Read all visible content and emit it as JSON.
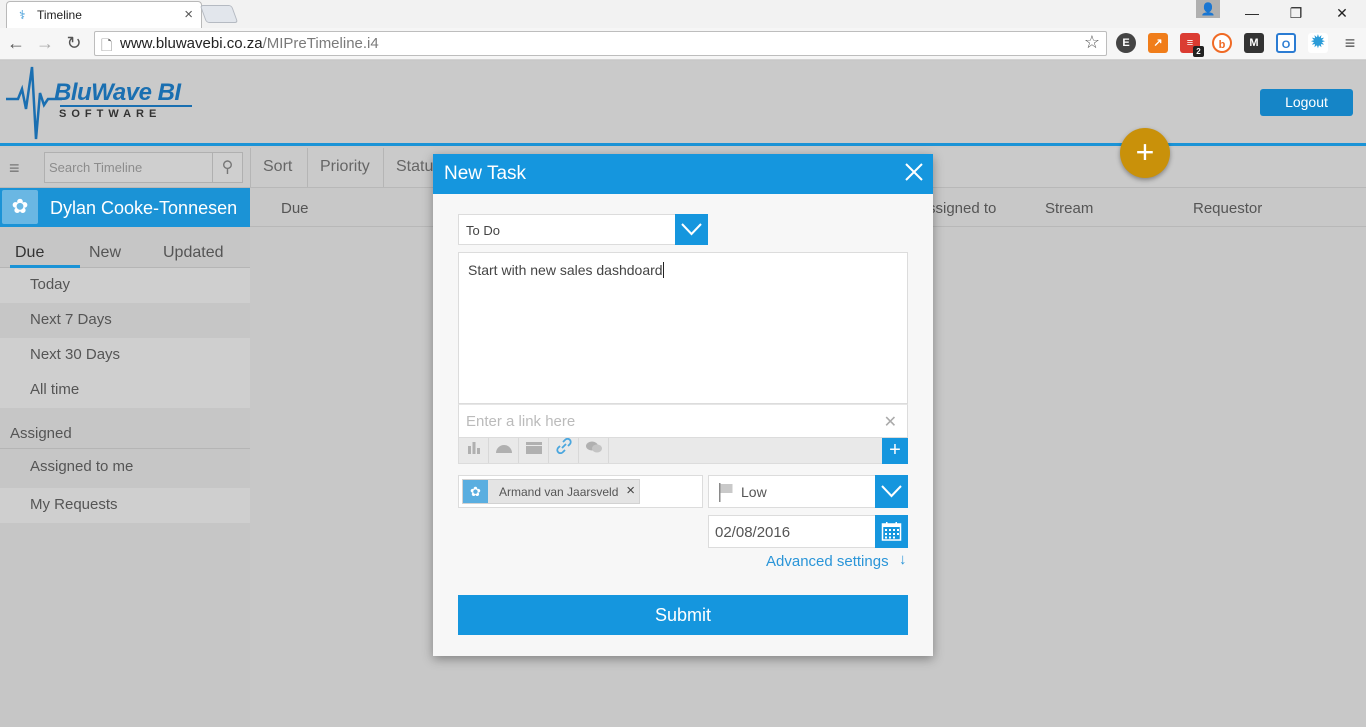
{
  "browser": {
    "tab_title": "Timeline",
    "url_domain": "www.bluwavebi.co.za",
    "url_path": "/MIPreTimeline.i4",
    "extension_badge": "2"
  },
  "header": {
    "logo_title": "BluWave BI",
    "logo_subtitle": "SOFTWARE",
    "logout_label": "Logout",
    "fab_label": "+"
  },
  "filterbar": {
    "search_placeholder": "Search Timeline",
    "items": [
      "Sort",
      "Priority",
      "Status"
    ]
  },
  "sidebar": {
    "user_name": "Dylan Cooke-Tonnesen",
    "tabs": [
      "Due",
      "New",
      "Updated"
    ],
    "due_items": [
      "Today",
      "Next 7 Days",
      "Next 30 Days",
      "All time"
    ],
    "assigned_heading": "Assigned",
    "assigned_items": [
      "Assigned to me",
      "My Requests"
    ]
  },
  "columns": [
    "Due",
    "Assigned to",
    "Stream",
    "Requestor"
  ],
  "modal": {
    "title": "New Task",
    "status_value": "To Do",
    "description": "Start with new sales dashdoard",
    "link_placeholder": "Enter a link here",
    "assignee": "Armand van Jaarsveld",
    "priority": "Low",
    "date": "02/08/2016",
    "advanced_label": "Advanced settings",
    "submit_label": "Submit"
  },
  "colors": {
    "accent": "#1596de",
    "fab": "#c9910a",
    "overlay_bg": "#c8c8c8"
  }
}
